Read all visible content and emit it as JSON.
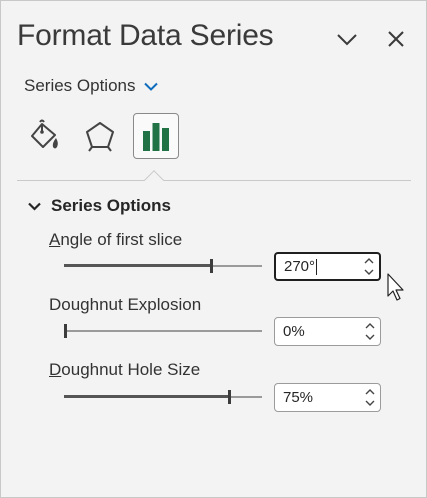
{
  "pane": {
    "title": "Format Data Series",
    "collapse_icon": "chevron-down-icon",
    "close_icon": "close-icon"
  },
  "series_dropdown": {
    "label": "Series Options",
    "icon": "chevron-down-icon",
    "accent": "#0f6cbd"
  },
  "tabs": [
    {
      "name": "fill-line",
      "icon": "paint-bucket-icon",
      "active": false
    },
    {
      "name": "effects",
      "icon": "pentagon-icon",
      "active": false
    },
    {
      "name": "series-options",
      "icon": "bar-chart-icon",
      "active": true,
      "color": "#217346"
    }
  ],
  "section": {
    "label": "Series Options",
    "expanded": true
  },
  "options": [
    {
      "label_access": "A",
      "label_rest": "ngle of first slice",
      "value": "270°",
      "slider_fraction": 0.75,
      "focused": true
    },
    {
      "label_access": "",
      "label_rest": "Doughnut Explosion",
      "value": "0%",
      "slider_fraction": 0.0,
      "focused": false
    },
    {
      "label_access": "D",
      "label_rest": "oughnut Hole Size",
      "value": "75%",
      "slider_fraction": 0.84,
      "focused": false
    }
  ]
}
